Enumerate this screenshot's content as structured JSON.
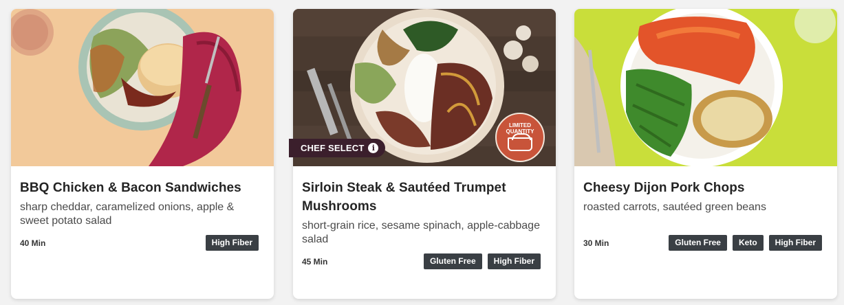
{
  "recipes": [
    {
      "title": "BBQ Chicken & Bacon Sandwiches",
      "subtitle": "sharp cheddar, caramelized onions, apple & sweet potato salad",
      "time": "40 Min",
      "tags": [
        "High Fiber"
      ]
    },
    {
      "title": "Sirloin Steak & Sautéed Trumpet Mushrooms",
      "subtitle": "short-grain rice, sesame spinach, apple-cabbage salad",
      "time": "45 Min",
      "tags": [
        "Gluten Free",
        "High Fiber"
      ],
      "badge": "CHEF SELECT",
      "limited_text": "LIMITED QUANTITY"
    },
    {
      "title": "Cheesy Dijon Pork Chops",
      "subtitle": "roasted carrots, sautéed green beans",
      "time": "30 Min",
      "tags": [
        "Gluten Free",
        "Keto",
        "High Fiber"
      ]
    }
  ],
  "colors": {
    "tag_bg": "#3a3f44",
    "badge_bg": "#3b1f2c",
    "limited_bg": "#c8543a",
    "page_bg": "#f2f2f2"
  }
}
